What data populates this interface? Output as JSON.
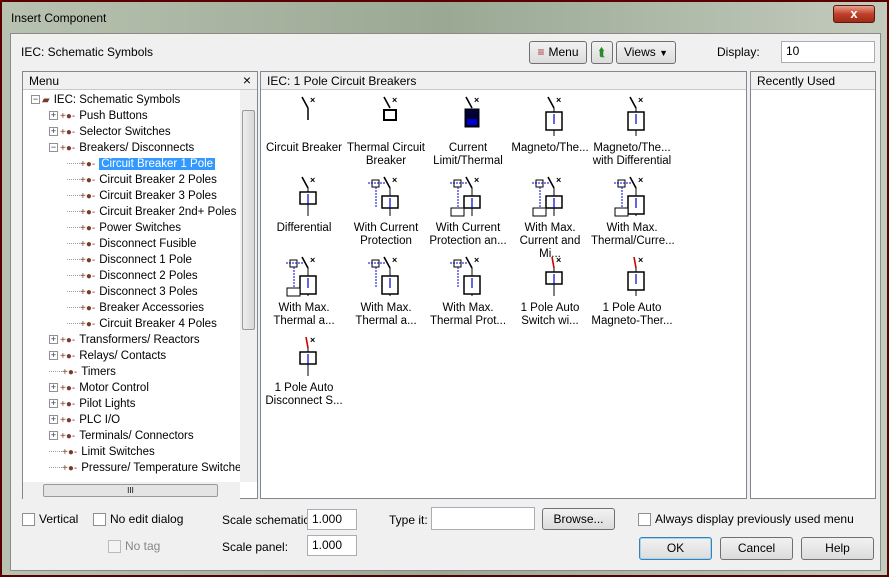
{
  "window": {
    "title": "Insert Component",
    "close": "x"
  },
  "toolbar": {
    "library": "IEC: Schematic Symbols",
    "menu_label": "Menu",
    "views_label": "Views",
    "display_label": "Display:",
    "display_value": "10"
  },
  "menu_panel": {
    "title": "Menu",
    "close": "×",
    "tree": [
      {
        "label": "IEC: Schematic Symbols",
        "level": 0,
        "expander": "−"
      },
      {
        "label": "Push Buttons",
        "level": 1,
        "expander": "+"
      },
      {
        "label": "Selector Switches",
        "level": 1,
        "expander": "+"
      },
      {
        "label": "Breakers/ Disconnects",
        "level": 1,
        "expander": "−"
      },
      {
        "label": "Circuit Breaker 1 Pole",
        "level": 2,
        "selected": true
      },
      {
        "label": "Circuit Breaker 2 Poles",
        "level": 2
      },
      {
        "label": "Circuit Breaker 3 Poles",
        "level": 2
      },
      {
        "label": "Circuit Breaker 2nd+ Poles",
        "level": 2
      },
      {
        "label": "Power Switches",
        "level": 2
      },
      {
        "label": "Disconnect Fusible",
        "level": 2
      },
      {
        "label": "Disconnect 1 Pole",
        "level": 2
      },
      {
        "label": "Disconnect 2 Poles",
        "level": 2
      },
      {
        "label": "Disconnect 3 Poles",
        "level": 2
      },
      {
        "label": "Breaker Accessories",
        "level": 2
      },
      {
        "label": "Circuit Breaker 4 Poles",
        "level": 2
      },
      {
        "label": "Transformers/ Reactors",
        "level": 1,
        "expander": "+"
      },
      {
        "label": "Relays/ Contacts",
        "level": 1,
        "expander": "+"
      },
      {
        "label": "Timers",
        "level": 1
      },
      {
        "label": "Motor Control",
        "level": 1,
        "expander": "+"
      },
      {
        "label": "Pilot Lights",
        "level": 1,
        "expander": "+"
      },
      {
        "label": "PLC I/O",
        "level": 1,
        "expander": "+"
      },
      {
        "label": "Terminals/ Connectors",
        "level": 1,
        "expander": "+"
      },
      {
        "label": "Limit Switches",
        "level": 1
      },
      {
        "label": "Pressure/ Temperature Switches",
        "level": 1
      }
    ],
    "hscroll_grip": "III"
  },
  "symbols_panel": {
    "title": "IEC: 1 Pole Circuit Breakers",
    "items": [
      {
        "line1": "Circuit Breaker",
        "line2": "",
        "icon": "breaker"
      },
      {
        "line1": "Thermal Circuit",
        "line2": "Breaker",
        "icon": "thermal"
      },
      {
        "line1": "Current",
        "line2": "Limit/Thermal",
        "icon": "current-limit"
      },
      {
        "line1": "Magneto/The...",
        "line2": "",
        "icon": "magneto"
      },
      {
        "line1": "Magneto/The...",
        "line2": "with Differential",
        "icon": "magneto-diff"
      },
      {
        "line1": "Differential",
        "line2": "",
        "icon": "differential"
      },
      {
        "line1": "With Current",
        "line2": "Protection",
        "icon": "current-prot"
      },
      {
        "line1": "With Current",
        "line2": "Protection an...",
        "icon": "current-prot-u"
      },
      {
        "line1": "With Max.",
        "line2": "Current and Mi...",
        "icon": "current-prot-u"
      },
      {
        "line1": "With Max.",
        "line2": "Thermal/Curre...",
        "icon": "thermal-prot-u"
      },
      {
        "line1": "With Max.",
        "line2": "Thermal a...",
        "icon": "thermal-prot-u"
      },
      {
        "line1": "With Max.",
        "line2": "Thermal a...",
        "icon": "thermal-prot"
      },
      {
        "line1": "With Max.",
        "line2": "Thermal Prot...",
        "icon": "thermal-prot"
      },
      {
        "line1": "1 Pole Auto",
        "line2": "Switch wi...",
        "icon": "auto-switch"
      },
      {
        "line1": "1 Pole Auto",
        "line2": "Magneto-Ther...",
        "icon": "auto-magneto"
      },
      {
        "line1": "1 Pole Auto",
        "line2": "Disconnect S...",
        "icon": "auto-disconnect"
      }
    ]
  },
  "recent_panel": {
    "title": "Recently Used"
  },
  "bottom": {
    "vertical": "Vertical",
    "no_edit": "No edit dialog",
    "no_tag": "No tag",
    "scale_schematic_label": "Scale schematic:",
    "scale_schematic": "1.000",
    "scale_panel_label": "Scale panel:",
    "scale_panel": "1.000",
    "type_it_label": "Type it:",
    "type_it": "",
    "browse": "Browse...",
    "always_display": "Always display previously used menu",
    "ok": "OK",
    "cancel": "Cancel",
    "help": "Help"
  },
  "colors": {
    "selection": "#3399ff",
    "frame": "#7a0d0d",
    "symbol_blue": "#0000cc",
    "symbol_red": "#cc0000"
  }
}
